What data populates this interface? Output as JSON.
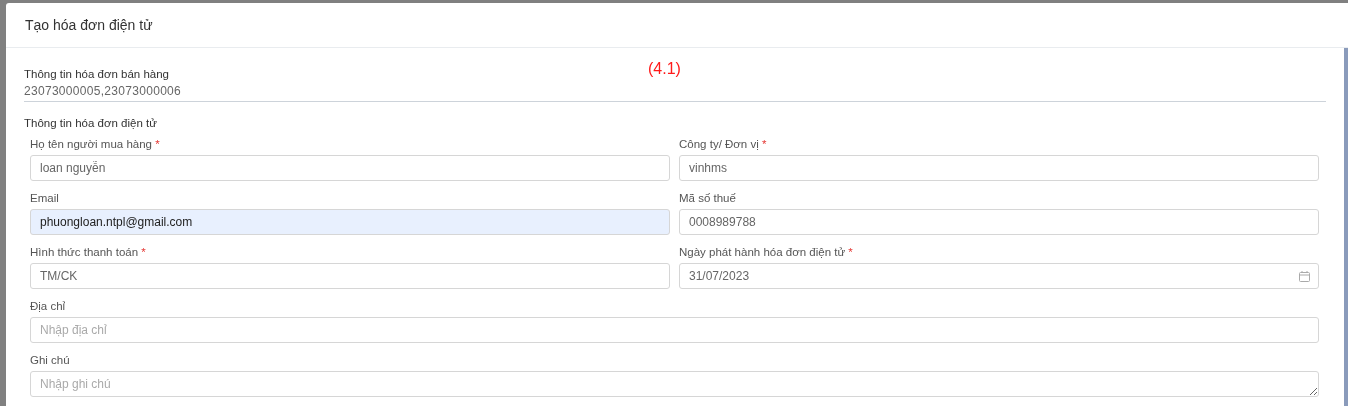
{
  "modal": {
    "title": "Tạo hóa đơn điện tử"
  },
  "annotation": "(4.1)",
  "sales_invoice": {
    "label": "Thông tin hóa đơn bán hàng",
    "value": "23073000005,23073000006"
  },
  "einvoice": {
    "label": "Thông tin hóa đơn điện tử",
    "required_mark": "*",
    "fields": [
      {
        "kind": "text",
        "label": "Họ tên người mua hàng",
        "required": true,
        "value": "loan nguyễn",
        "autofilled": false,
        "wide": false
      },
      {
        "kind": "text",
        "label": "Công ty/ Đơn vị",
        "required": true,
        "value": "vinhms",
        "autofilled": false,
        "wide": false
      },
      {
        "kind": "text",
        "label": "Email",
        "required": false,
        "value": "phuongloan.ntpl@gmail.com",
        "autofilled": true,
        "wide": false
      },
      {
        "kind": "text",
        "label": "Mã số thuế",
        "required": false,
        "value": "0008989788",
        "autofilled": false,
        "wide": false
      },
      {
        "kind": "text",
        "label": "Hình thức thanh toán",
        "required": true,
        "value": "TM/CK",
        "autofilled": false,
        "wide": false
      },
      {
        "kind": "date",
        "label": "Ngày phát hành hóa đơn điện tử",
        "required": true,
        "value": "31/07/2023",
        "autofilled": false,
        "wide": false
      },
      {
        "kind": "text",
        "label": "Địa chỉ",
        "required": false,
        "placeholder": "Nhập địa chỉ",
        "autofilled": false,
        "wide": true
      },
      {
        "kind": "textarea",
        "label": "Ghi chú",
        "required": false,
        "placeholder": "Nhập ghi chú",
        "autofilled": false,
        "wide": true
      }
    ]
  }
}
